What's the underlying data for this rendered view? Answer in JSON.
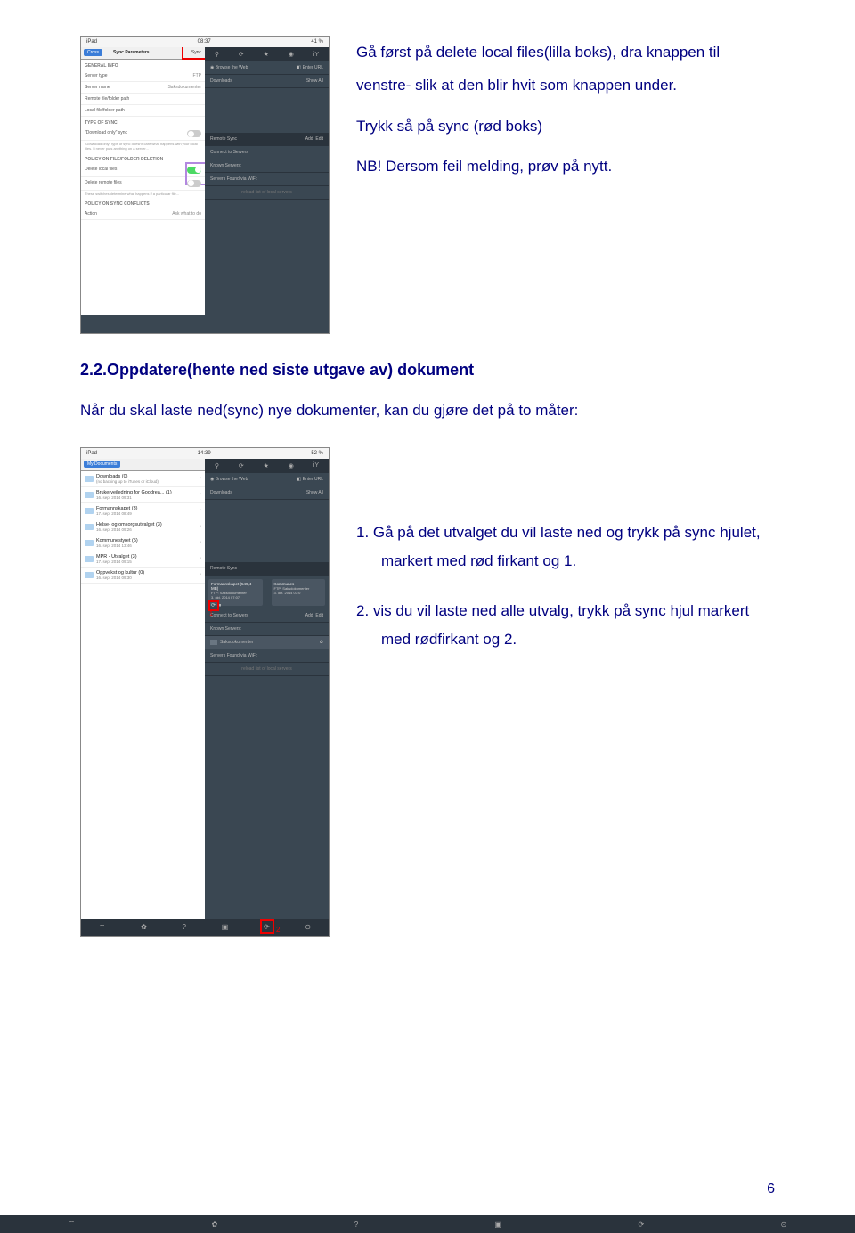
{
  "section1": {
    "p1": "Gå først på delete local files(lilla boks), dra knappen til venstre- slik at den blir hvit som knappen under.",
    "p2": "Trykk så på sync (rød boks)",
    "p3": "NB! Dersom feil melding, prøv på nytt."
  },
  "heading": "2.2.Oppdatere(hente ned siste utgave av) dokument",
  "subtext": "Når du skal laste ned(sync) nye dokumenter, kan du gjøre det på to måter:",
  "list": {
    "item1": "1.  Gå på det utvalget du vil laste ned og trykk på sync hjulet, markert med rød firkant og 1.",
    "item2": "2.  vis du vil laste ned alle utvalg, trykk på sync hjul markert med rødfirkant og 2."
  },
  "screenshot1": {
    "statusbar_left": "iPad",
    "statusbar_mid": "08:37",
    "statusbar_right": "41 %",
    "cross": "Cross",
    "syncparams": "Sync Parameters",
    "sync": "Sync",
    "general": "GENERAL INFO",
    "servertype": "Server type",
    "servertype_val": "FTP",
    "servername": "Server name",
    "servername_val": "Saksdokumenter",
    "remotepath": "Remote file/folder path",
    "localpath": "Local file/folder path",
    "typeofsync": "TYPE OF SYNC",
    "downloadonly": "\"Download only\" sync",
    "policy_del": "POLICY ON FILE/FOLDER DELETION",
    "del_local": "Delete local files",
    "del_remote": "Delete remote files",
    "policy_conf": "POLICY ON SYNC CONFLICTS",
    "action": "Action",
    "action_val": "Ask what to do",
    "browse": "Browse the Web",
    "enterurl": "Enter URL",
    "downloads_r": "Downloads",
    "showall": "Show All",
    "remotesync": "Remote Sync",
    "add": "Add",
    "edit": "Edit",
    "connectto": "Connect to Servers",
    "known": "Known Servers:",
    "servers_found": "Servers Found via WiFi:",
    "reload": "reload list of local servers"
  },
  "screenshot2": {
    "statusbar_left": "iPad",
    "statusbar_mid": "14:39",
    "statusbar_right": "52 %",
    "mydocs": "My Documents",
    "downloads": "Downloads (0)",
    "downloads_sub": "(no backing up to iTunes or iCloud)",
    "item1_t": "Brukerveiledning for Goodrea... (1)",
    "item1_s": "16. sep. 2014 09:31",
    "item2_t": "Formannskapet (3)",
    "item2_s": "17. sep. 2014 08:49",
    "item3_t": "Helse- og omsorgsutvalget (3)",
    "item3_s": "16. sep. 2014 09:26",
    "item4_t": "Kommunestyret (5)",
    "item4_s": "16. sep. 2014 13:46",
    "item5_t": "MPR - Utvalget (3)",
    "item5_s": "17. sep. 2014 09:15",
    "item6_t": "Oppvekst og kultur (0)",
    "item6_s": "16. sep. 2014 09:30",
    "browse": "Browse the Web",
    "enterurl": "Enter URL",
    "downloads_r": "Downloads",
    "showall": "Show All",
    "remotesync": "Remote Sync",
    "tile1_t": "Formannskapet (549,4 MB)",
    "tile1_s": "FTP: Saksdokumenter",
    "tile1_d": "3. okt. 2014 07:07",
    "tile2_t": "Kommunes",
    "tile2_s": "FTP: Saksdokumenter",
    "tile2_d": "3. okt. 2014 07:0",
    "connectto": "Connect to Servers",
    "add": "Add",
    "edit": "Edit",
    "known": "Known Servers:",
    "saksdok": "Saksdokumenter",
    "servers_found": "Servers Found via WiFi:",
    "reload": "reload list of local servers",
    "marker1": "1",
    "marker2": "2"
  },
  "page_num": "6"
}
